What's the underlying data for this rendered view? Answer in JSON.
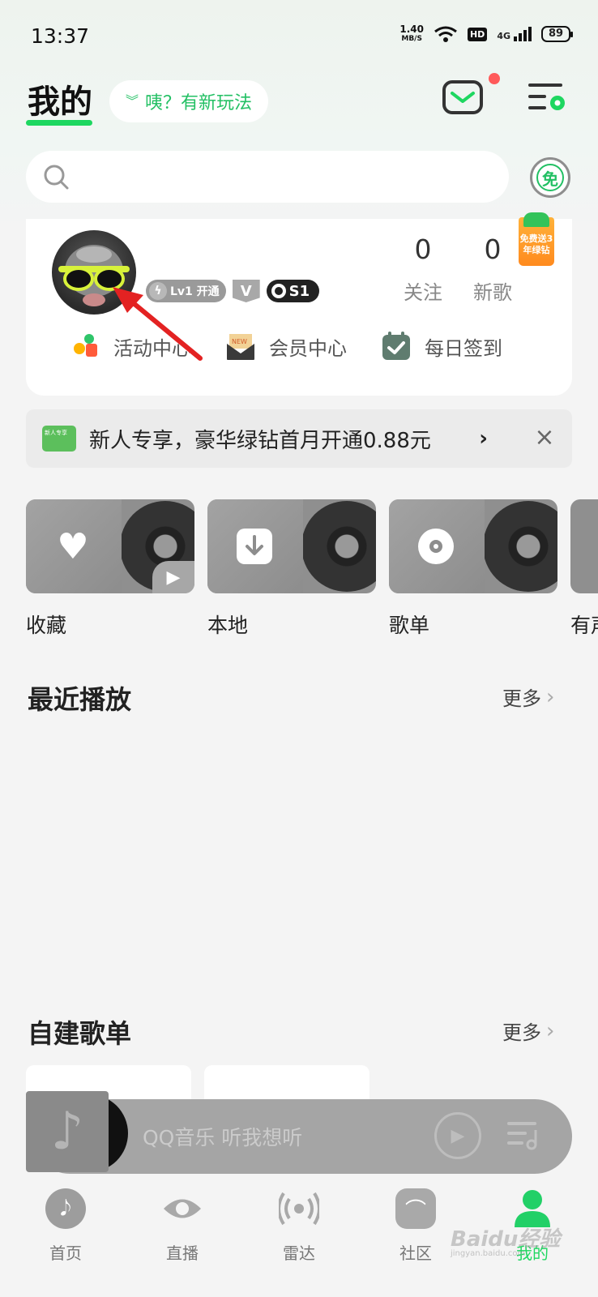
{
  "status_bar": {
    "time": "13:37",
    "net_speed_value": "1.40",
    "net_speed_unit": "MB/S",
    "hd_label": "HD",
    "network_label": "4G",
    "battery": "89"
  },
  "header": {
    "title": "我的",
    "new_play_label": "咦？有新玩法",
    "search_placeholder": "",
    "free_label": "免"
  },
  "profile": {
    "level_badge": "Lv1 开通",
    "v_badge": "V",
    "s_badge": "S1",
    "stats": [
      {
        "value": "0",
        "label": "关注"
      },
      {
        "value": "0",
        "label": "新歌"
      }
    ],
    "promo_tag": "免费送3年绿钻",
    "quick_links": [
      {
        "label": "活动中心",
        "icon": "gift-icon"
      },
      {
        "label": "会员中心",
        "icon": "envelope-new-icon"
      },
      {
        "label": "每日签到",
        "icon": "calendar-check-icon"
      }
    ]
  },
  "banner": {
    "text": "新人专享，豪华绿钻首月开通0.88元",
    "close": "×"
  },
  "categories": [
    {
      "label": "收藏",
      "icon": "heart-icon"
    },
    {
      "label": "本地",
      "icon": "download-icon"
    },
    {
      "label": "歌单",
      "icon": "disc-icon"
    },
    {
      "label": "有声",
      "icon": "audiobook-icon"
    }
  ],
  "recent": {
    "title": "最近播放",
    "more": "更多"
  },
  "playlists": {
    "title": "自建歌单",
    "more": "更多"
  },
  "mini_player": {
    "title": "QQ音乐 听我想听"
  },
  "tabs": [
    {
      "label": "首页",
      "icon": "music-note-icon"
    },
    {
      "label": "直播",
      "icon": "eye-icon"
    },
    {
      "label": "雷达",
      "icon": "radar-icon"
    },
    {
      "label": "社区",
      "icon": "community-icon"
    },
    {
      "label": "我的",
      "icon": "user-icon"
    }
  ],
  "watermark": {
    "text": "Baidu经验",
    "sub": "jingyan.baidu.com"
  },
  "colors": {
    "accent": "#1ed760",
    "banner_bg": "#ebebeb",
    "promo_orange": "#ff8a1e"
  }
}
